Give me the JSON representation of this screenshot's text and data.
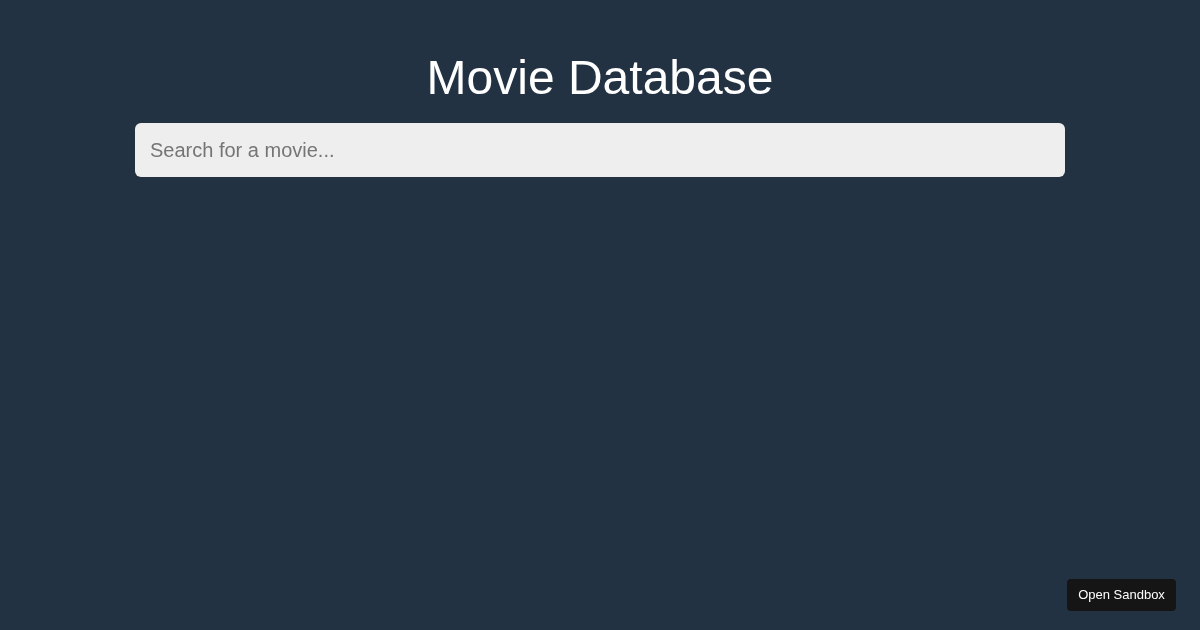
{
  "title": "Movie Database",
  "search": {
    "placeholder": "Search for a movie..."
  },
  "sandbox_button": {
    "label": "Open Sandbox"
  }
}
